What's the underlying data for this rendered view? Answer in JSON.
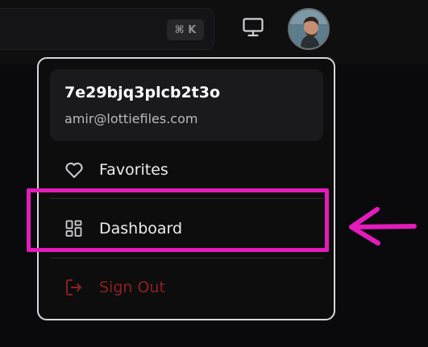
{
  "search": {
    "shortcut": "⌘ K"
  },
  "header": {
    "monitor_icon": "monitor-icon",
    "avatar_icon": "user-avatar"
  },
  "user_menu": {
    "username": "7e29bjq3plcb2t3o",
    "email": "amir@lottiefiles.com",
    "items": [
      {
        "label": "Favorites",
        "icon": "heart-icon"
      },
      {
        "label": "Dashboard",
        "icon": "dashboard-grid-icon"
      },
      {
        "label": "Sign Out",
        "icon": "sign-out-icon"
      }
    ]
  },
  "annotation": {
    "highlight_color": "#e21cba",
    "arrow_icon": "arrow-left-icon"
  },
  "colors": {
    "background": "#0a0a0c",
    "menu_border": "#d8d8da",
    "sign_out": "#8e2020"
  }
}
